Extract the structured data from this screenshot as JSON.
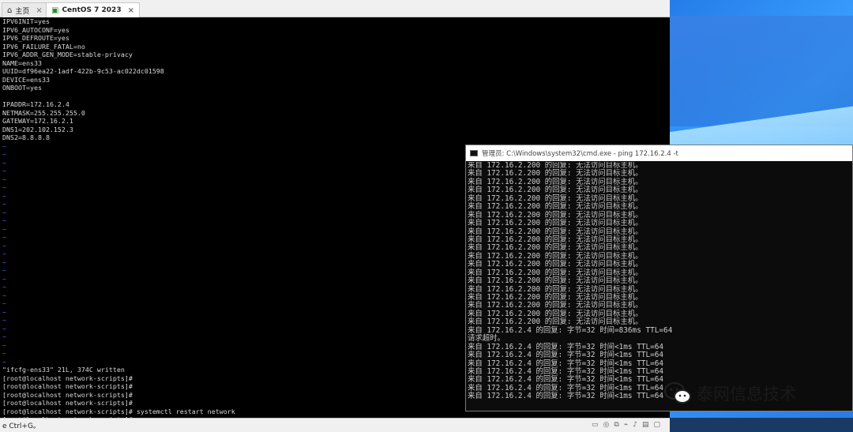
{
  "tabs": [
    {
      "label": "主页",
      "icon": "home-icon"
    },
    {
      "label": "CentOS 7 2023",
      "icon": "vm-icon"
    }
  ],
  "terminal_lines": [
    "IPV6INIT=yes",
    "IPV6_AUTOCONF=yes",
    "IPV6_DEFROUTE=yes",
    "IPV6_FAILURE_FATAL=no",
    "IPV6_ADDR_GEN_MODE=stable-privacy",
    "NAME=ens33",
    "UUID=df96ea22-1adf-422b-9c53-ac022dc01598",
    "DEVICE=ens33",
    "ONBOOT=yes",
    "",
    "IPADDR=172.16.2.4",
    "NETMASK=255.255.255.0",
    "GATEWAY=172.16.2.1",
    "DNS1=202.102.152.3",
    "DNS2=8.8.8.8"
  ],
  "tilde_count": 27,
  "terminal_tail": [
    "\"ifcfg-ens33\" 21L, 374C written",
    "[root@localhost network-scripts]#",
    "[root@localhost network-scripts]#",
    "[root@localhost network-scripts]#",
    "[root@localhost network-scripts]#",
    "[root@localhost network-scripts]# systemctl restart network",
    "[root@localhost network-scripts]# _"
  ],
  "vm_status_text": "e Ctrl+G。",
  "cmd": {
    "title": "管理员: C:\\Windows\\system32\\cmd.exe - ping  172.16.2.4 -t",
    "unreachable_line": "来自 172.16.2.200 的回复: 无法访问目标主机。",
    "unreachable_count": 20,
    "first_reply": "来自 172.16.2.4 的回复: 字节=32 时间=836ms TTL=64",
    "timeout": "请求超时。",
    "reply_line": "来自 172.16.2.4 的回复: 字节=32 时间<1ms TTL=64",
    "reply_count": 7
  },
  "watermark": "泰网信息技术",
  "colors": {
    "tilde": "#3c6cff",
    "terminal_fg": "#d8d8d8",
    "cmd_fg": "#cccccc"
  }
}
